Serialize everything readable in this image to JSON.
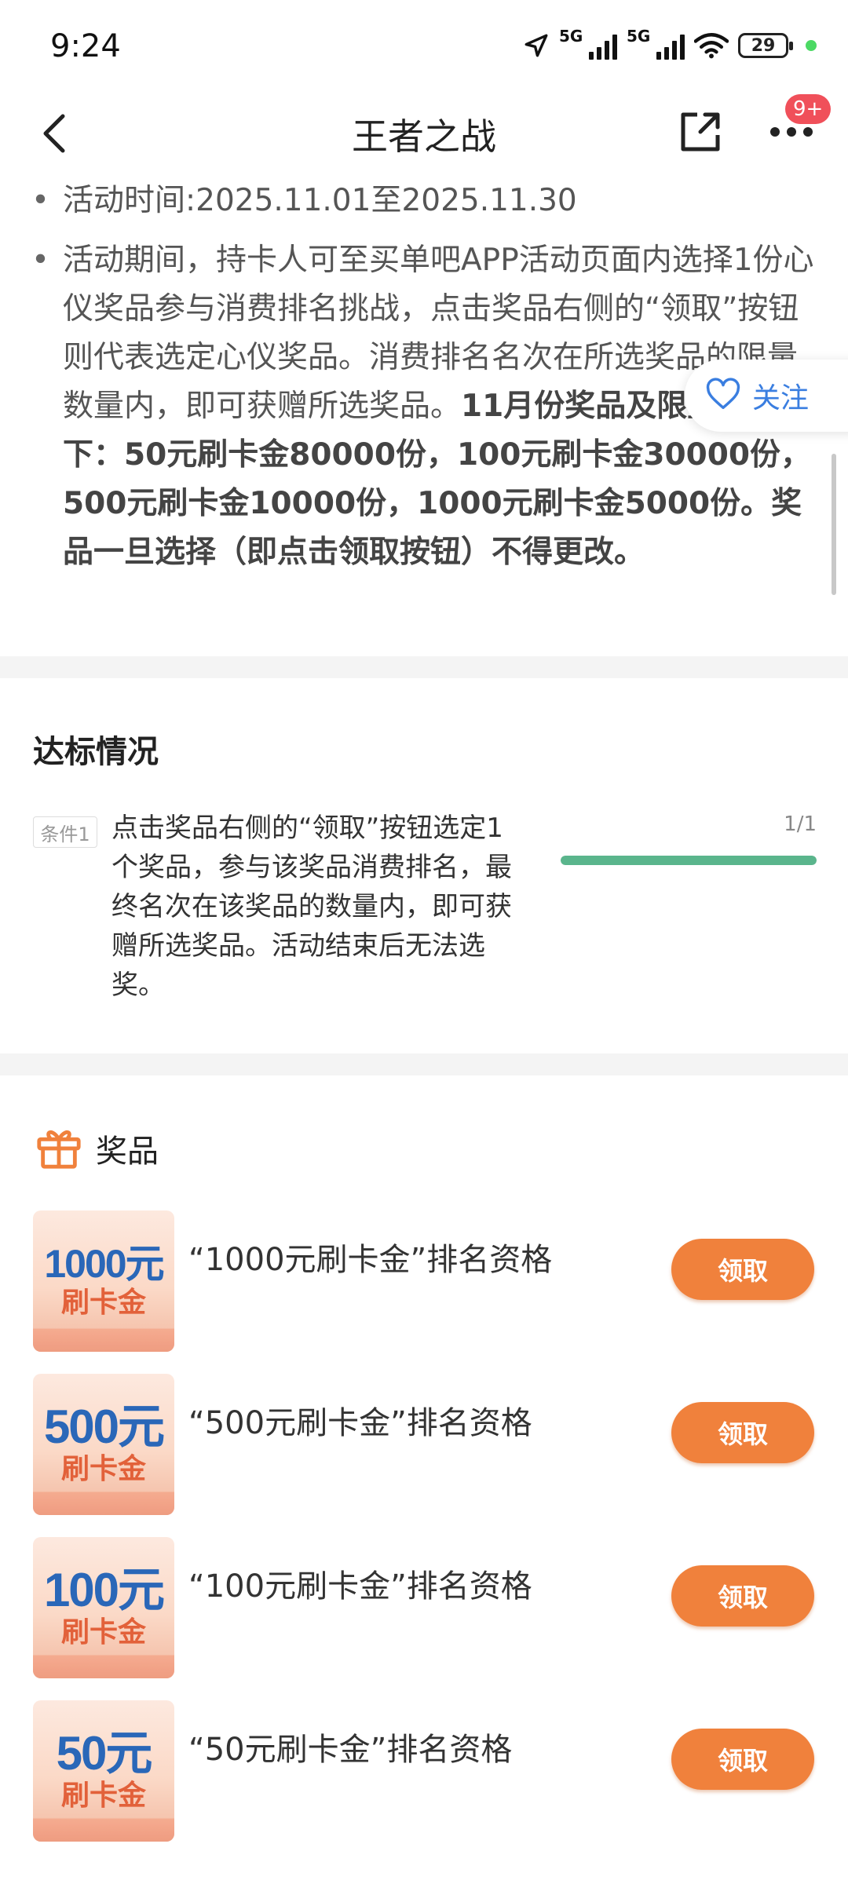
{
  "status_bar": {
    "time": "9:24",
    "net1": "5G",
    "net2": "5G",
    "battery": "29"
  },
  "nav": {
    "title": "王者之战",
    "badge": "9+"
  },
  "rules": {
    "time_line": "活动时间:2025.11.01至2025.11.30",
    "desc_normal": "活动期间，持卡人可至买单吧APP活动页面内选择1份心仪奖品参与消费排名挑战，点击奖品右侧的“领取”按钮则代表选定心仪奖品。消费排名名次在所选奖品的限量数量内，即可获赠所选奖品。",
    "desc_bold": "11月份奖品及限量数如下：50元刷卡金80000份，100元刷卡金30000份，500元刷卡金10000份，1000元刷卡金5000份。奖品一旦选择（即点击领取按钮）不得更改。"
  },
  "follow": {
    "label": "关注"
  },
  "qualification": {
    "title": "达标情况",
    "condition_tag": "条件1",
    "condition_text": "点击奖品右侧的“领取”按钮选定1个奖品，参与该奖品消费排名，最终名次在该奖品的数量内，即可获赠所选奖品。活动结束后无法选奖。",
    "count": "1/1",
    "progress": 1.0,
    "progress_color": "#5ab58c"
  },
  "prizes": {
    "title": "奖品",
    "button_label": "领取",
    "button_color": "#f0813c",
    "items": [
      {
        "amount": "1000元",
        "sub": "刷卡金",
        "name": "“1000元刷卡金”排名资格"
      },
      {
        "amount": "500元",
        "sub": "刷卡金",
        "name": "“500元刷卡金”排名资格"
      },
      {
        "amount": "100元",
        "sub": "刷卡金",
        "name": "“100元刷卡金”排名资格"
      },
      {
        "amount": "50元",
        "sub": "刷卡金",
        "name": "“50元刷卡金”排名资格"
      }
    ]
  },
  "icons": [
    "back-arrow-icon",
    "share-icon",
    "more-icon",
    "heart-icon",
    "gift-icon",
    "location-arrow-icon",
    "signal-icon",
    "wifi-icon",
    "battery-icon"
  ]
}
